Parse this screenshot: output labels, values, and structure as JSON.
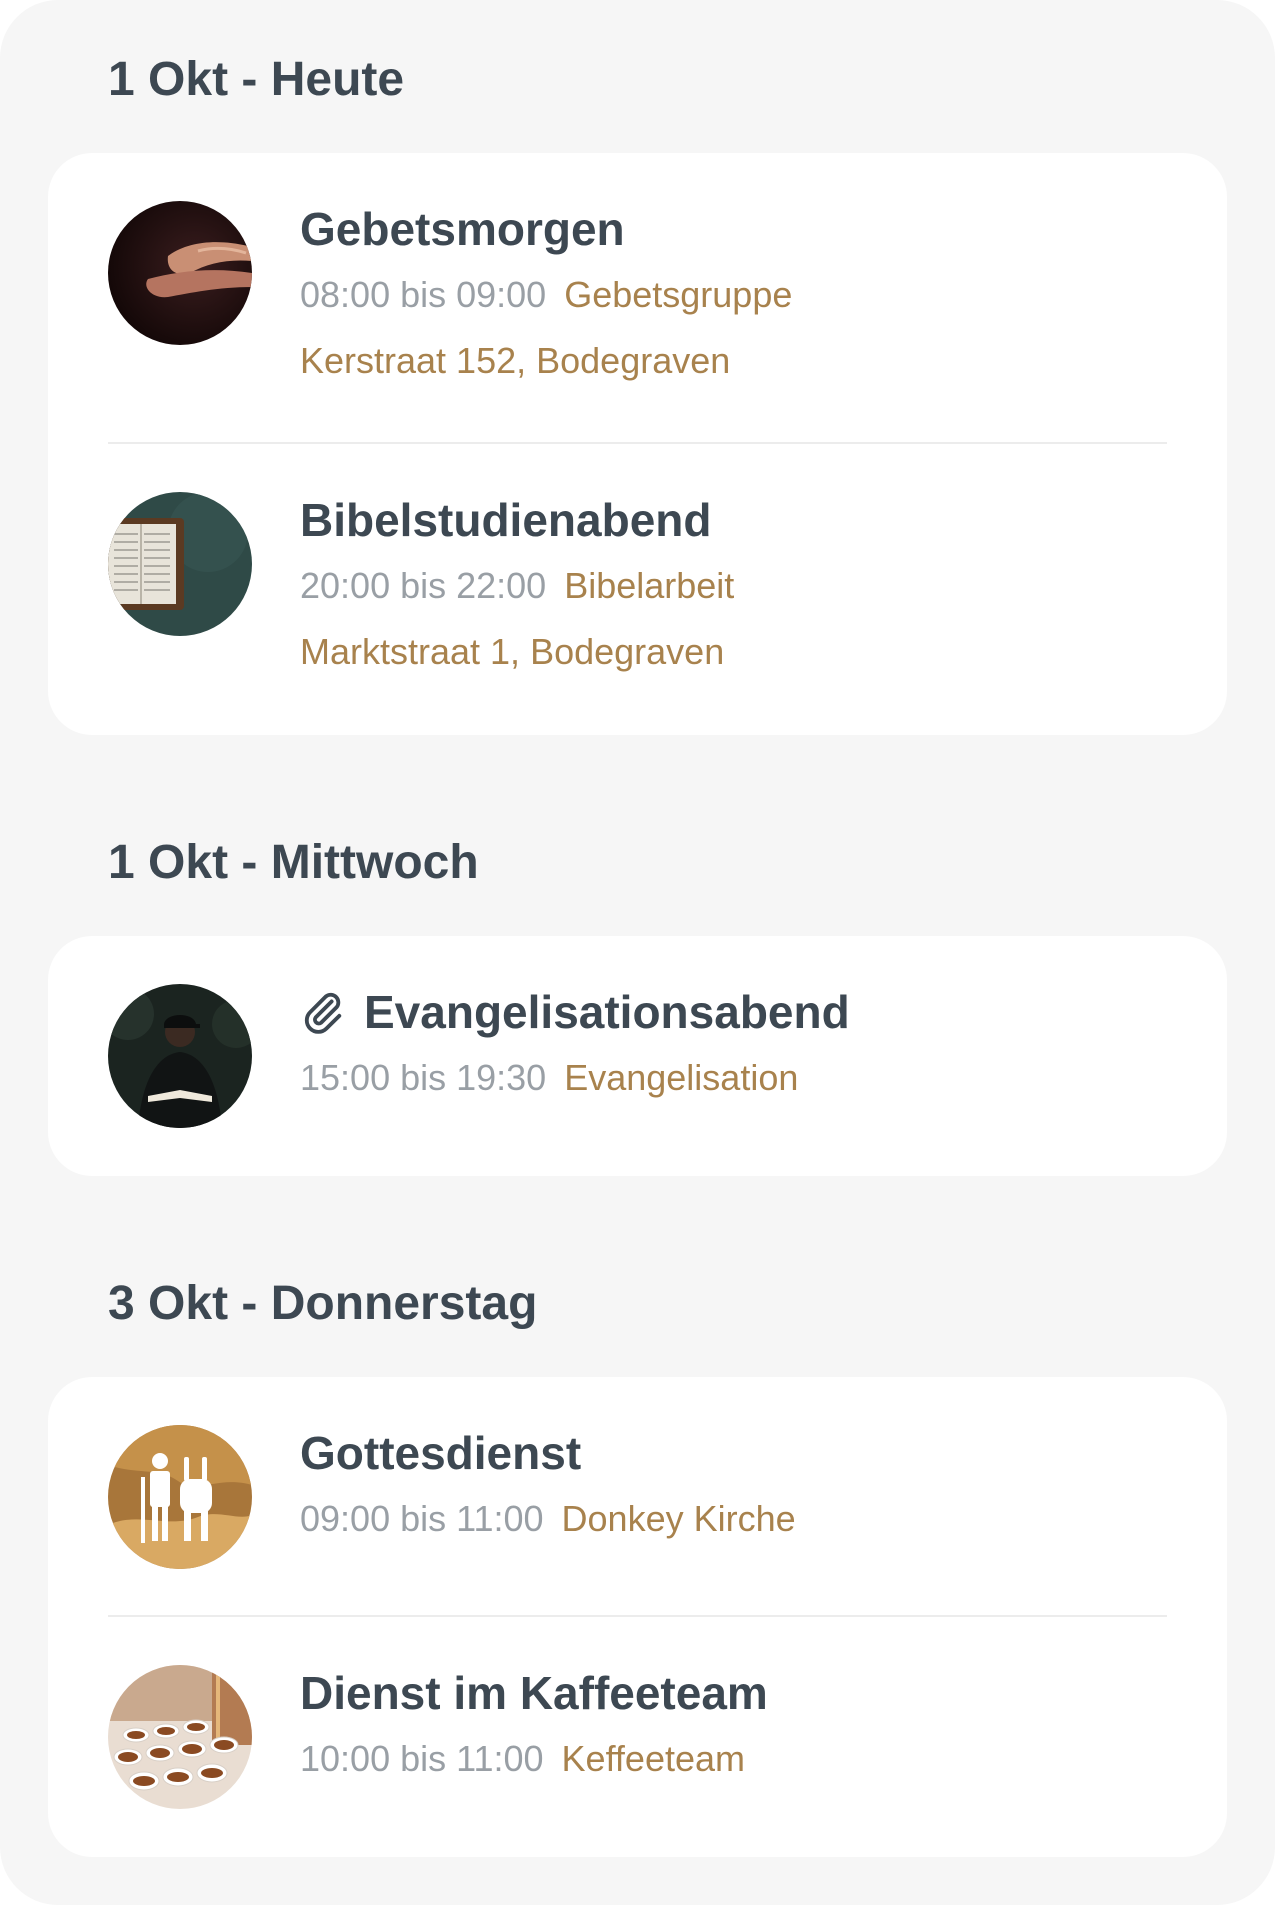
{
  "sections": [
    {
      "heading": "1 Okt - Heute",
      "events": [
        {
          "title": "Gebetsmorgen",
          "time": "08:00 bis 09:00",
          "category": "Gebetsgruppe",
          "address": "Kerstraat 152, Bodegraven",
          "image": "praying-hands-photo"
        },
        {
          "title": "Bibelstudienabend",
          "time": "20:00 bis 22:00",
          "category": "Bibelarbeit",
          "address": "Marktstraat 1, Bodegraven",
          "image": "open-bible-photo"
        }
      ]
    },
    {
      "heading": "1 Okt - Mittwoch",
      "events": [
        {
          "title": "Evangelisationsabend",
          "time": "15:00 bis 19:30",
          "category": "Evangelisation",
          "image": "man-reading-book-photo",
          "icon": "paperclip-icon"
        }
      ]
    },
    {
      "heading": "3 Okt - Donnerstag",
      "events": [
        {
          "title": "Gottesdienst",
          "time": "09:00 bis 11:00",
          "category": "Donkey Kirche",
          "image": "donkey-church-logo"
        },
        {
          "title": "Dienst im Kaffeeteam",
          "time": "10:00 bis 11:00",
          "category": "Keffeeteam",
          "image": "coffee-cups-photo"
        }
      ]
    }
  ],
  "colors": {
    "background": "#f6f6f6",
    "card": "#ffffff",
    "heading_text": "#3d4852",
    "time_text": "#999fa5",
    "accent": "#a8824d"
  }
}
